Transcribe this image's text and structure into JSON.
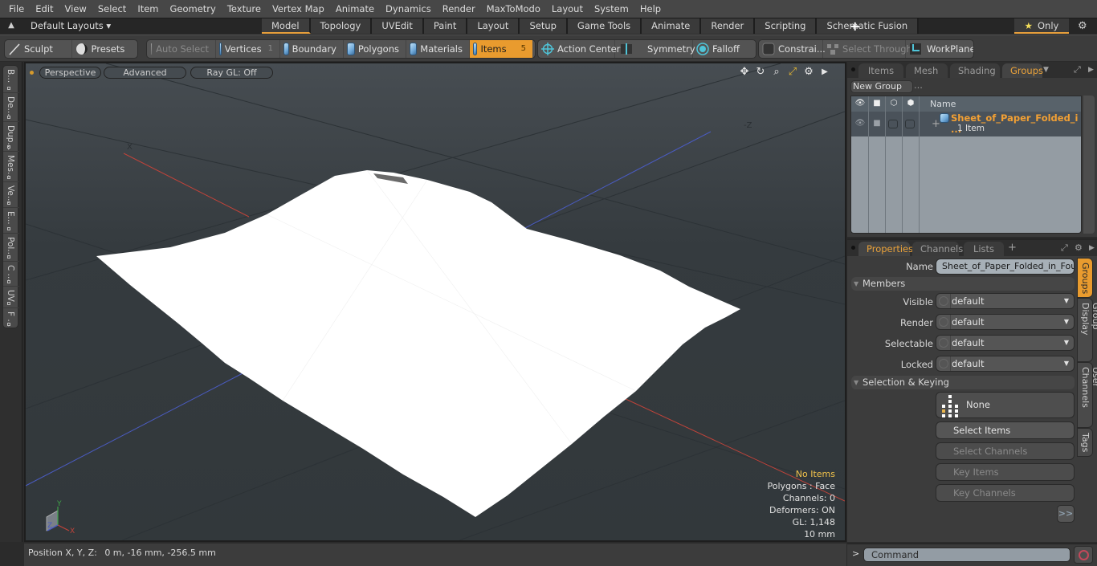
{
  "menu": [
    "File",
    "Edit",
    "View",
    "Select",
    "Item",
    "Geometry",
    "Texture",
    "Vertex Map",
    "Animate",
    "Dynamics",
    "Render",
    "MaxToModo",
    "Layout",
    "System",
    "Help"
  ],
  "layoutbar": {
    "layouts_label": "Default Layouts ▾",
    "tabs": [
      "Model",
      "Topology",
      "UVEdit",
      "Paint",
      "Layout",
      "Setup",
      "Game Tools",
      "Animate",
      "Render",
      "Scripting",
      "Schematic Fusion"
    ],
    "active_tab": "Model",
    "add_tab": "+",
    "only_label": "Only",
    "star_icon": "★",
    "gear_icon": "⚙"
  },
  "toolbar": {
    "sculpt": "Sculpt",
    "presets": "Presets",
    "auto_select": "Auto Select",
    "vertices": "Vertices",
    "vertices_count": "1",
    "boundary": "Boundary",
    "polygons": "Polygons",
    "materials": "Materials",
    "items": "Items",
    "items_count": "5",
    "action_center": "Action Center",
    "symmetry": "Symmetry",
    "falloff": "Falloff",
    "constraints": "Constrai...",
    "select_through": "Select Through",
    "workplane": "WorkPlane"
  },
  "left_tabs": [
    "B...",
    "De...",
    "Dup...",
    "Mes...",
    "Ve...",
    "E...",
    "Pol...",
    "C ...",
    "UV",
    "F ..."
  ],
  "viewport": {
    "view_mode": "Perspective",
    "shading": "Advanced",
    "raygl": "Ray GL: Off",
    "axis_x_label": "X",
    "axis_z_label": "-Z",
    "info": {
      "selection": "No Items",
      "polygons": "Polygons : Face",
      "channels": "Channels: 0",
      "deformers": "Deformers: ON",
      "gl": "GL: 1,148",
      "scale": "10 mm"
    },
    "gizmo": {
      "x": "X",
      "y": "Y",
      "z": "Z"
    }
  },
  "statusbar": {
    "position_label": "Position X, Y, Z:",
    "position_value": "0 m, -16 mm, -256.5 mm"
  },
  "groups_panel": {
    "tabs": [
      "Items",
      "Mesh ...",
      "Shading",
      "Groups"
    ],
    "active_tab": "Groups",
    "new_group": "New Group",
    "column_name": "Name",
    "rows": [
      {
        "name": "Sheet_of_Paper_Folded_i ...",
        "sub": "1 Item"
      }
    ]
  },
  "properties_panel": {
    "tabs": [
      "Properties",
      "Channels",
      "Lists"
    ],
    "active_tab": "Properties",
    "add_tab": "+",
    "name_label": "Name",
    "name_value": "Sheet_of_Paper_Folded_in_Four",
    "members_section": "Members",
    "fields": [
      {
        "label": "Visible",
        "value": "default"
      },
      {
        "label": "Render",
        "value": "default"
      },
      {
        "label": "Selectable",
        "value": "default"
      },
      {
        "label": "Locked",
        "value": "default"
      }
    ],
    "selection_section": "Selection & Keying",
    "selection_mode": "None",
    "buttons": [
      {
        "label": "Select Items",
        "enabled": true
      },
      {
        "label": "Select Channels",
        "enabled": false
      },
      {
        "label": "Key Items",
        "enabled": false
      },
      {
        "label": "Key Channels",
        "enabled": false
      }
    ],
    "more": ">>",
    "side_tabs": [
      "Groups",
      "Group Display",
      "User Channels",
      "Tags"
    ],
    "active_side_tab": "Groups"
  },
  "command": {
    "prompt": ">",
    "placeholder": "Command"
  },
  "colors": {
    "accent": "#e99b2e",
    "highlight_text": "#f1c24b",
    "axis_x": "#c0433a",
    "axis_z": "#4a5bbf",
    "group_name": "#f2a034"
  }
}
